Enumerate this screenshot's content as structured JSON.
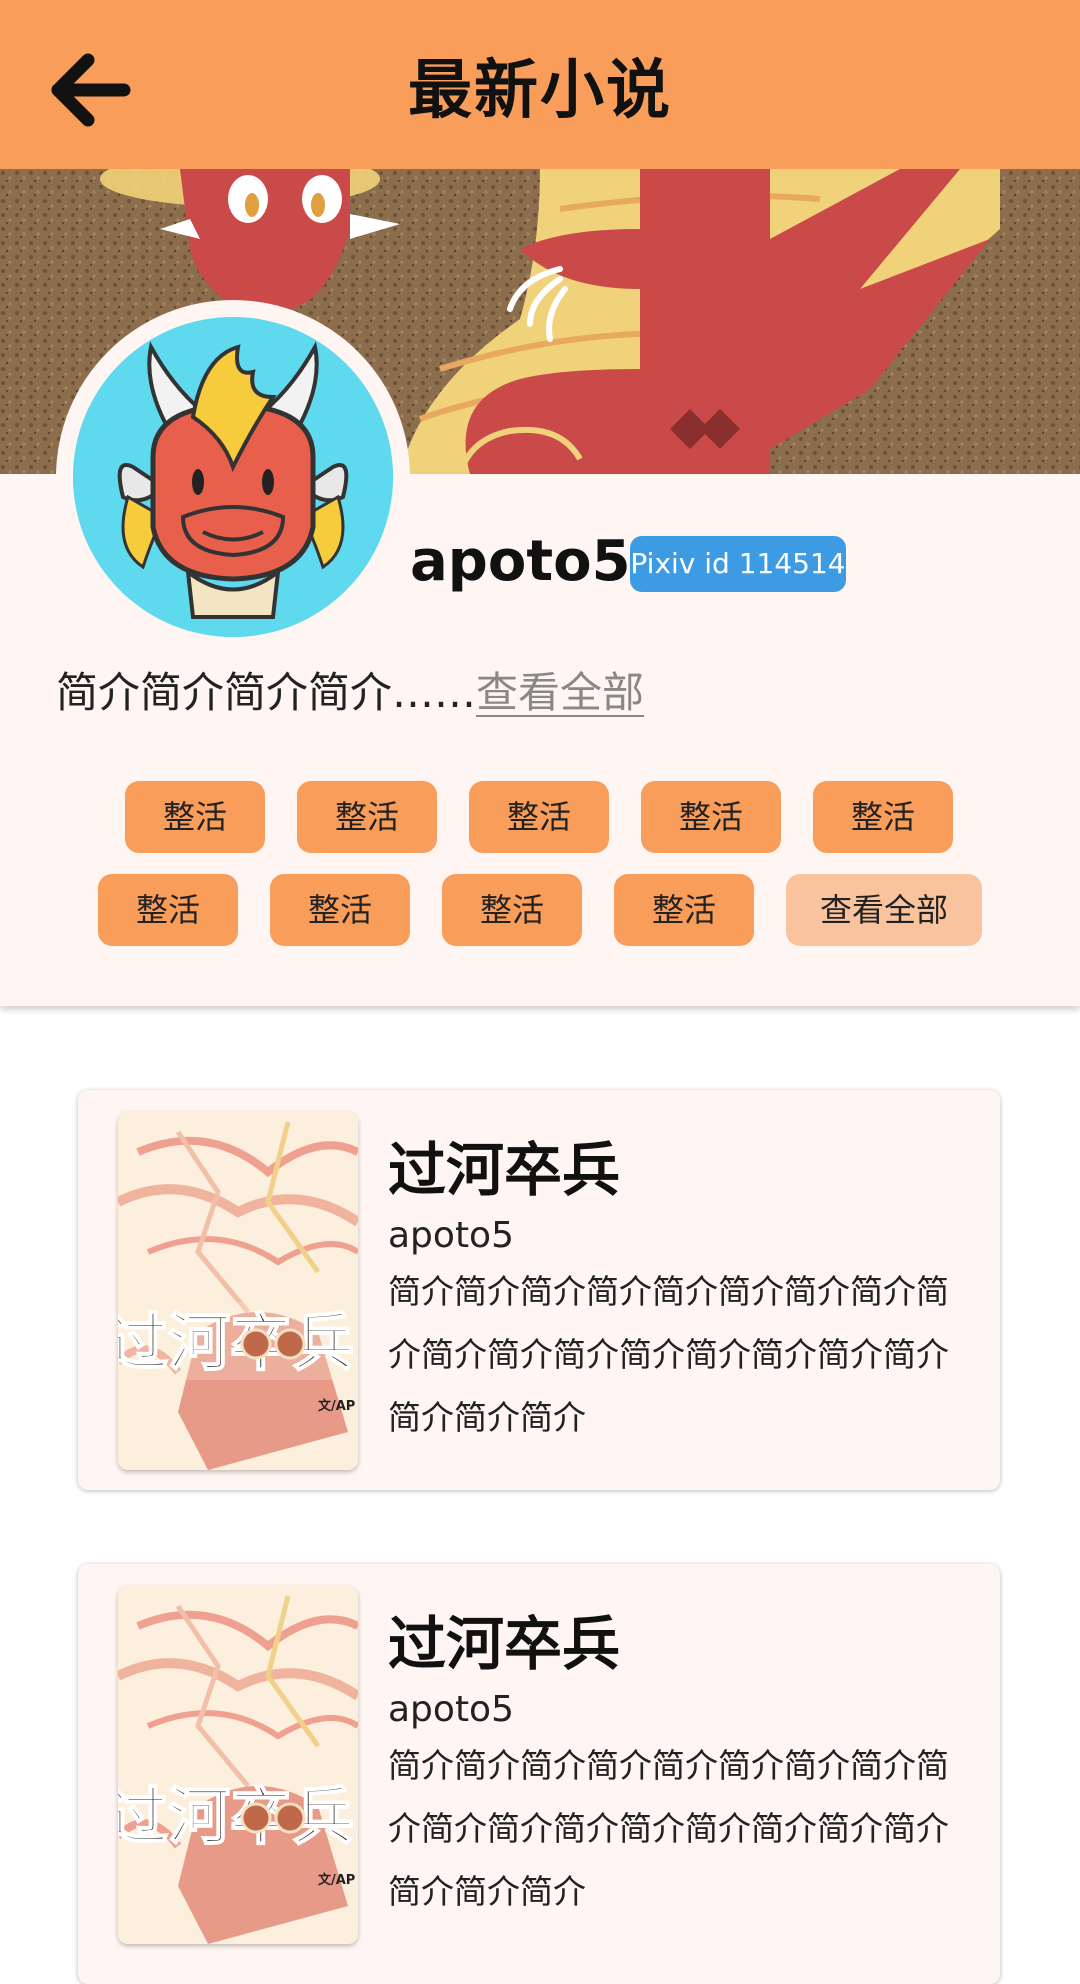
{
  "header": {
    "title": "最新小说",
    "back_icon": "arrow-left-icon"
  },
  "profile": {
    "username": "apoto5",
    "pixiv_badge": "Pixiv id 114514",
    "bio": "简介简介简介简介……",
    "bio_more": "查看全部",
    "tags": [
      "整活",
      "整活",
      "整活",
      "整活",
      "整活",
      "整活",
      "整活",
      "整活",
      "整活"
    ],
    "tags_more": "查看全部"
  },
  "novels": [
    {
      "title": "过河卒兵",
      "author": "apoto5",
      "description": "简介简介简介简介简介简介简介简介简介简介简介简介简介简介简介简介简介简介简介简介",
      "cover_text": "过河卒兵"
    },
    {
      "title": "过河卒兵",
      "author": "apoto5",
      "description": "简介简介简介简介简介简介简介简介简介简介简介简介简介简介简介简介简介简介简介简介",
      "cover_text": "过河卒兵"
    }
  ],
  "colors": {
    "accent": "#f99d5a",
    "accent_light": "#f9c39e",
    "badge_blue": "#3d9be3",
    "panel_bg": "#fff5f2"
  }
}
